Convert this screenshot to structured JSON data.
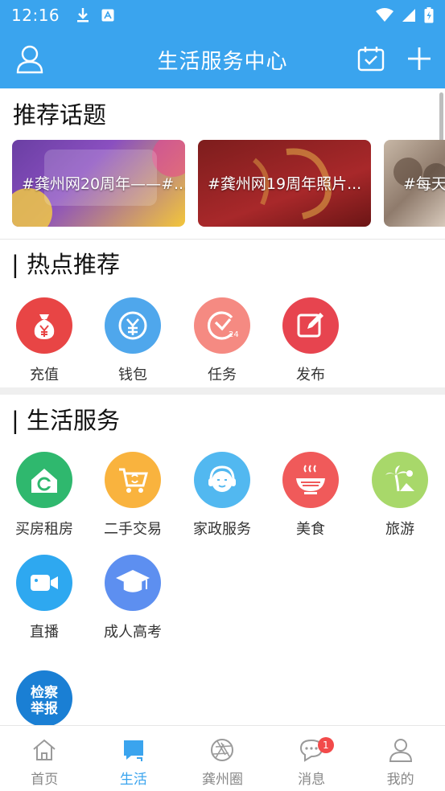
{
  "status": {
    "time": "12:16"
  },
  "header": {
    "title": "生活服务中心"
  },
  "topics": {
    "title": "推荐话题",
    "items": [
      {
        "label": "#龚州网20周年——#..."
      },
      {
        "label": "#龚州网19周年照片..."
      },
      {
        "label": "#每天"
      }
    ]
  },
  "hot": {
    "title": "| 热点推荐",
    "items": [
      {
        "label": "充值",
        "color": "#e84545"
      },
      {
        "label": "钱包",
        "color": "#4fa7ec"
      },
      {
        "label": "任务",
        "color": "#f58a82"
      },
      {
        "label": "发布",
        "color": "#e7444f"
      }
    ]
  },
  "life": {
    "title": "| 生活服务",
    "items": [
      {
        "label": "买房租房",
        "color": "#2fb86e"
      },
      {
        "label": "二手交易",
        "color": "#f9b33e"
      },
      {
        "label": "家政服务",
        "color": "#52b8f0"
      },
      {
        "label": "美食",
        "color": "#f05a5a"
      },
      {
        "label": "旅游",
        "color": "#a8d86a"
      },
      {
        "label": "直播",
        "color": "#2ea8f0"
      },
      {
        "label": "成人高考",
        "color": "#5d8ff0"
      },
      {
        "label": "检察举报",
        "color": "#1a7fd4"
      }
    ]
  },
  "tabs": [
    {
      "label": "首页"
    },
    {
      "label": "生活"
    },
    {
      "label": "龚州圈"
    },
    {
      "label": "消息",
      "badge": "1"
    },
    {
      "label": "我的"
    }
  ]
}
